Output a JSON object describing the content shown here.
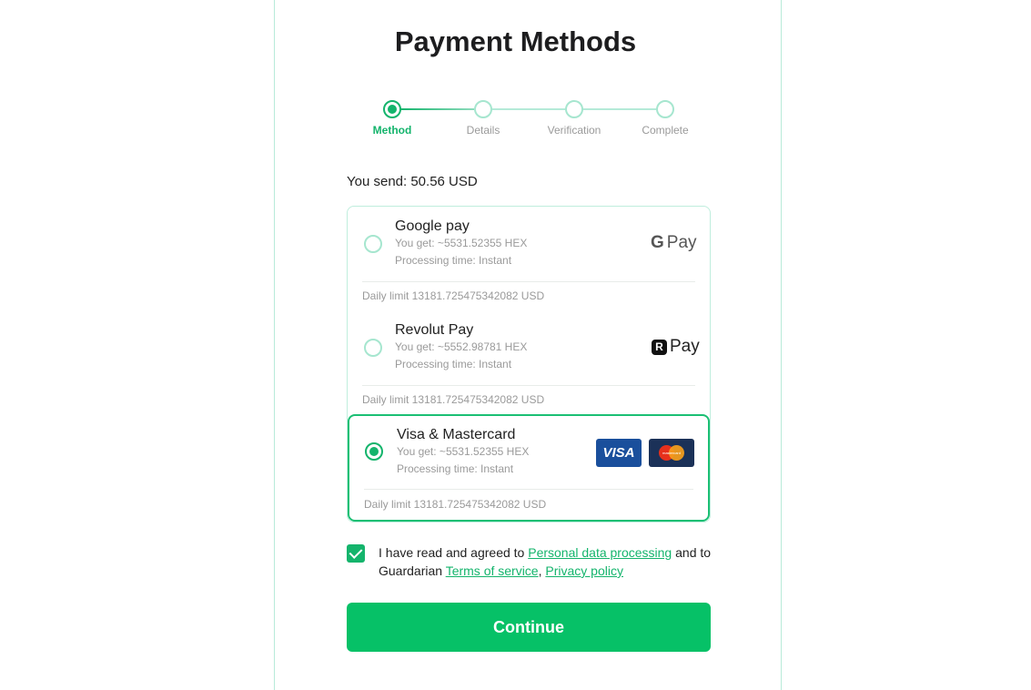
{
  "title": "Payment Methods",
  "steps": [
    {
      "label": "Method",
      "active": true
    },
    {
      "label": "Details",
      "active": false
    },
    {
      "label": "Verification",
      "active": false
    },
    {
      "label": "Complete",
      "active": false
    }
  ],
  "send_label": "You send: 50.56 USD",
  "methods": [
    {
      "name": "Google pay",
      "you_get": "You get: ~5531.52355 HEX",
      "processing": "Processing time: Instant",
      "limit": "Daily limit 13181.725475342082 USD",
      "logo_g": "G",
      "logo_text": "Pay",
      "selected": false
    },
    {
      "name": "Revolut Pay",
      "you_get": "You get: ~5552.98781 HEX",
      "processing": "Processing time: Instant",
      "limit": "Daily limit 13181.725475342082 USD",
      "logo_r": "R",
      "logo_text": "Pay",
      "selected": false
    },
    {
      "name": "Visa & Mastercard",
      "you_get": "You get: ~5531.52355 HEX",
      "processing": "Processing time: Instant",
      "limit": "Daily limit 13181.725475342082 USD",
      "visa_text": "VISA",
      "mc_text": "mastercard",
      "selected": true
    }
  ],
  "consent": {
    "text_1": "I have read and agreed to ",
    "link_1": "Personal data processing",
    "text_2": " and to Guardarian ",
    "link_2": "Terms of service",
    "text_3": ", ",
    "link_3": "Privacy policy",
    "checked": true
  },
  "continue_label": "Continue",
  "colors": {
    "accent": "#14b46c",
    "button": "#06c167",
    "muted": "#9a9a9a"
  }
}
